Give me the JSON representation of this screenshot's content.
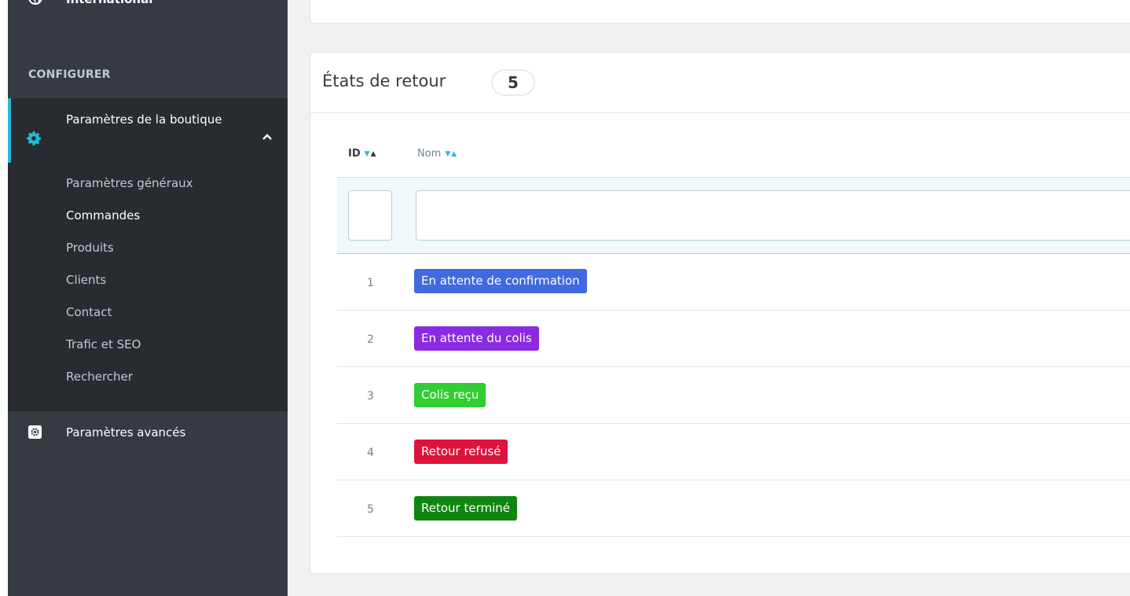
{
  "sidebar": {
    "top_item": {
      "label": "International"
    },
    "section_title": "CONFIGURER",
    "active_group": {
      "label": "Paramètres de la boutique",
      "submenu": [
        {
          "label": "Paramètres généraux",
          "current": false
        },
        {
          "label": "Commandes",
          "current": true
        },
        {
          "label": "Produits",
          "current": false
        },
        {
          "label": "Clients",
          "current": false
        },
        {
          "label": "Contact",
          "current": false
        },
        {
          "label": "Trafic et SEO",
          "current": false
        },
        {
          "label": "Rechercher",
          "current": false
        }
      ]
    },
    "advanced": {
      "label": "Paramètres avancés"
    }
  },
  "panel": {
    "title": "États de retour",
    "count": "5",
    "columns": {
      "id": "ID",
      "nom": "Nom"
    },
    "rows": [
      {
        "id": "1",
        "name": "En attente de confirmation",
        "color": "#4169e1"
      },
      {
        "id": "2",
        "name": "En attente du colis",
        "color": "#8a2be2"
      },
      {
        "id": "3",
        "name": "Colis reçu",
        "color": "#32cd32"
      },
      {
        "id": "4",
        "name": "Retour refusé",
        "color": "#dc143c"
      },
      {
        "id": "5",
        "name": "Retour terminé",
        "color": "#108510"
      }
    ]
  },
  "theme": {
    "sidebar_bg": "#363a41",
    "accent": "#25b9d7"
  }
}
